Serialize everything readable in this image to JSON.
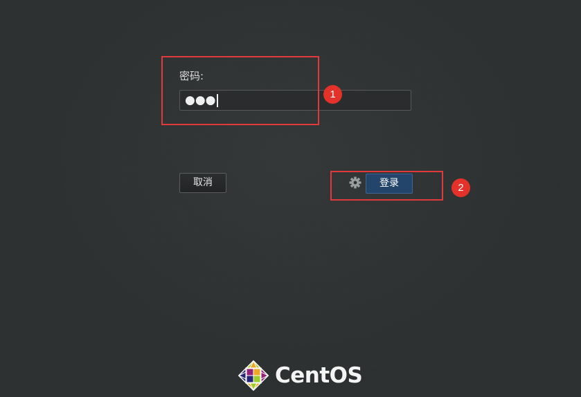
{
  "login": {
    "password_label": "密码:",
    "password_masked": "●●●",
    "cancel_label": "取消",
    "login_label": "登录"
  },
  "annotations": {
    "badge_1": "1",
    "badge_2": "2",
    "highlight_color": "#e23a3a",
    "badge_color": "#e4322b"
  },
  "branding": {
    "logo_text": "CentOS"
  },
  "colors": {
    "background": "#2d3031",
    "login_button": "#23446b"
  },
  "icons": {
    "settings": "gear-icon",
    "logo": "centos-logo-icon"
  }
}
